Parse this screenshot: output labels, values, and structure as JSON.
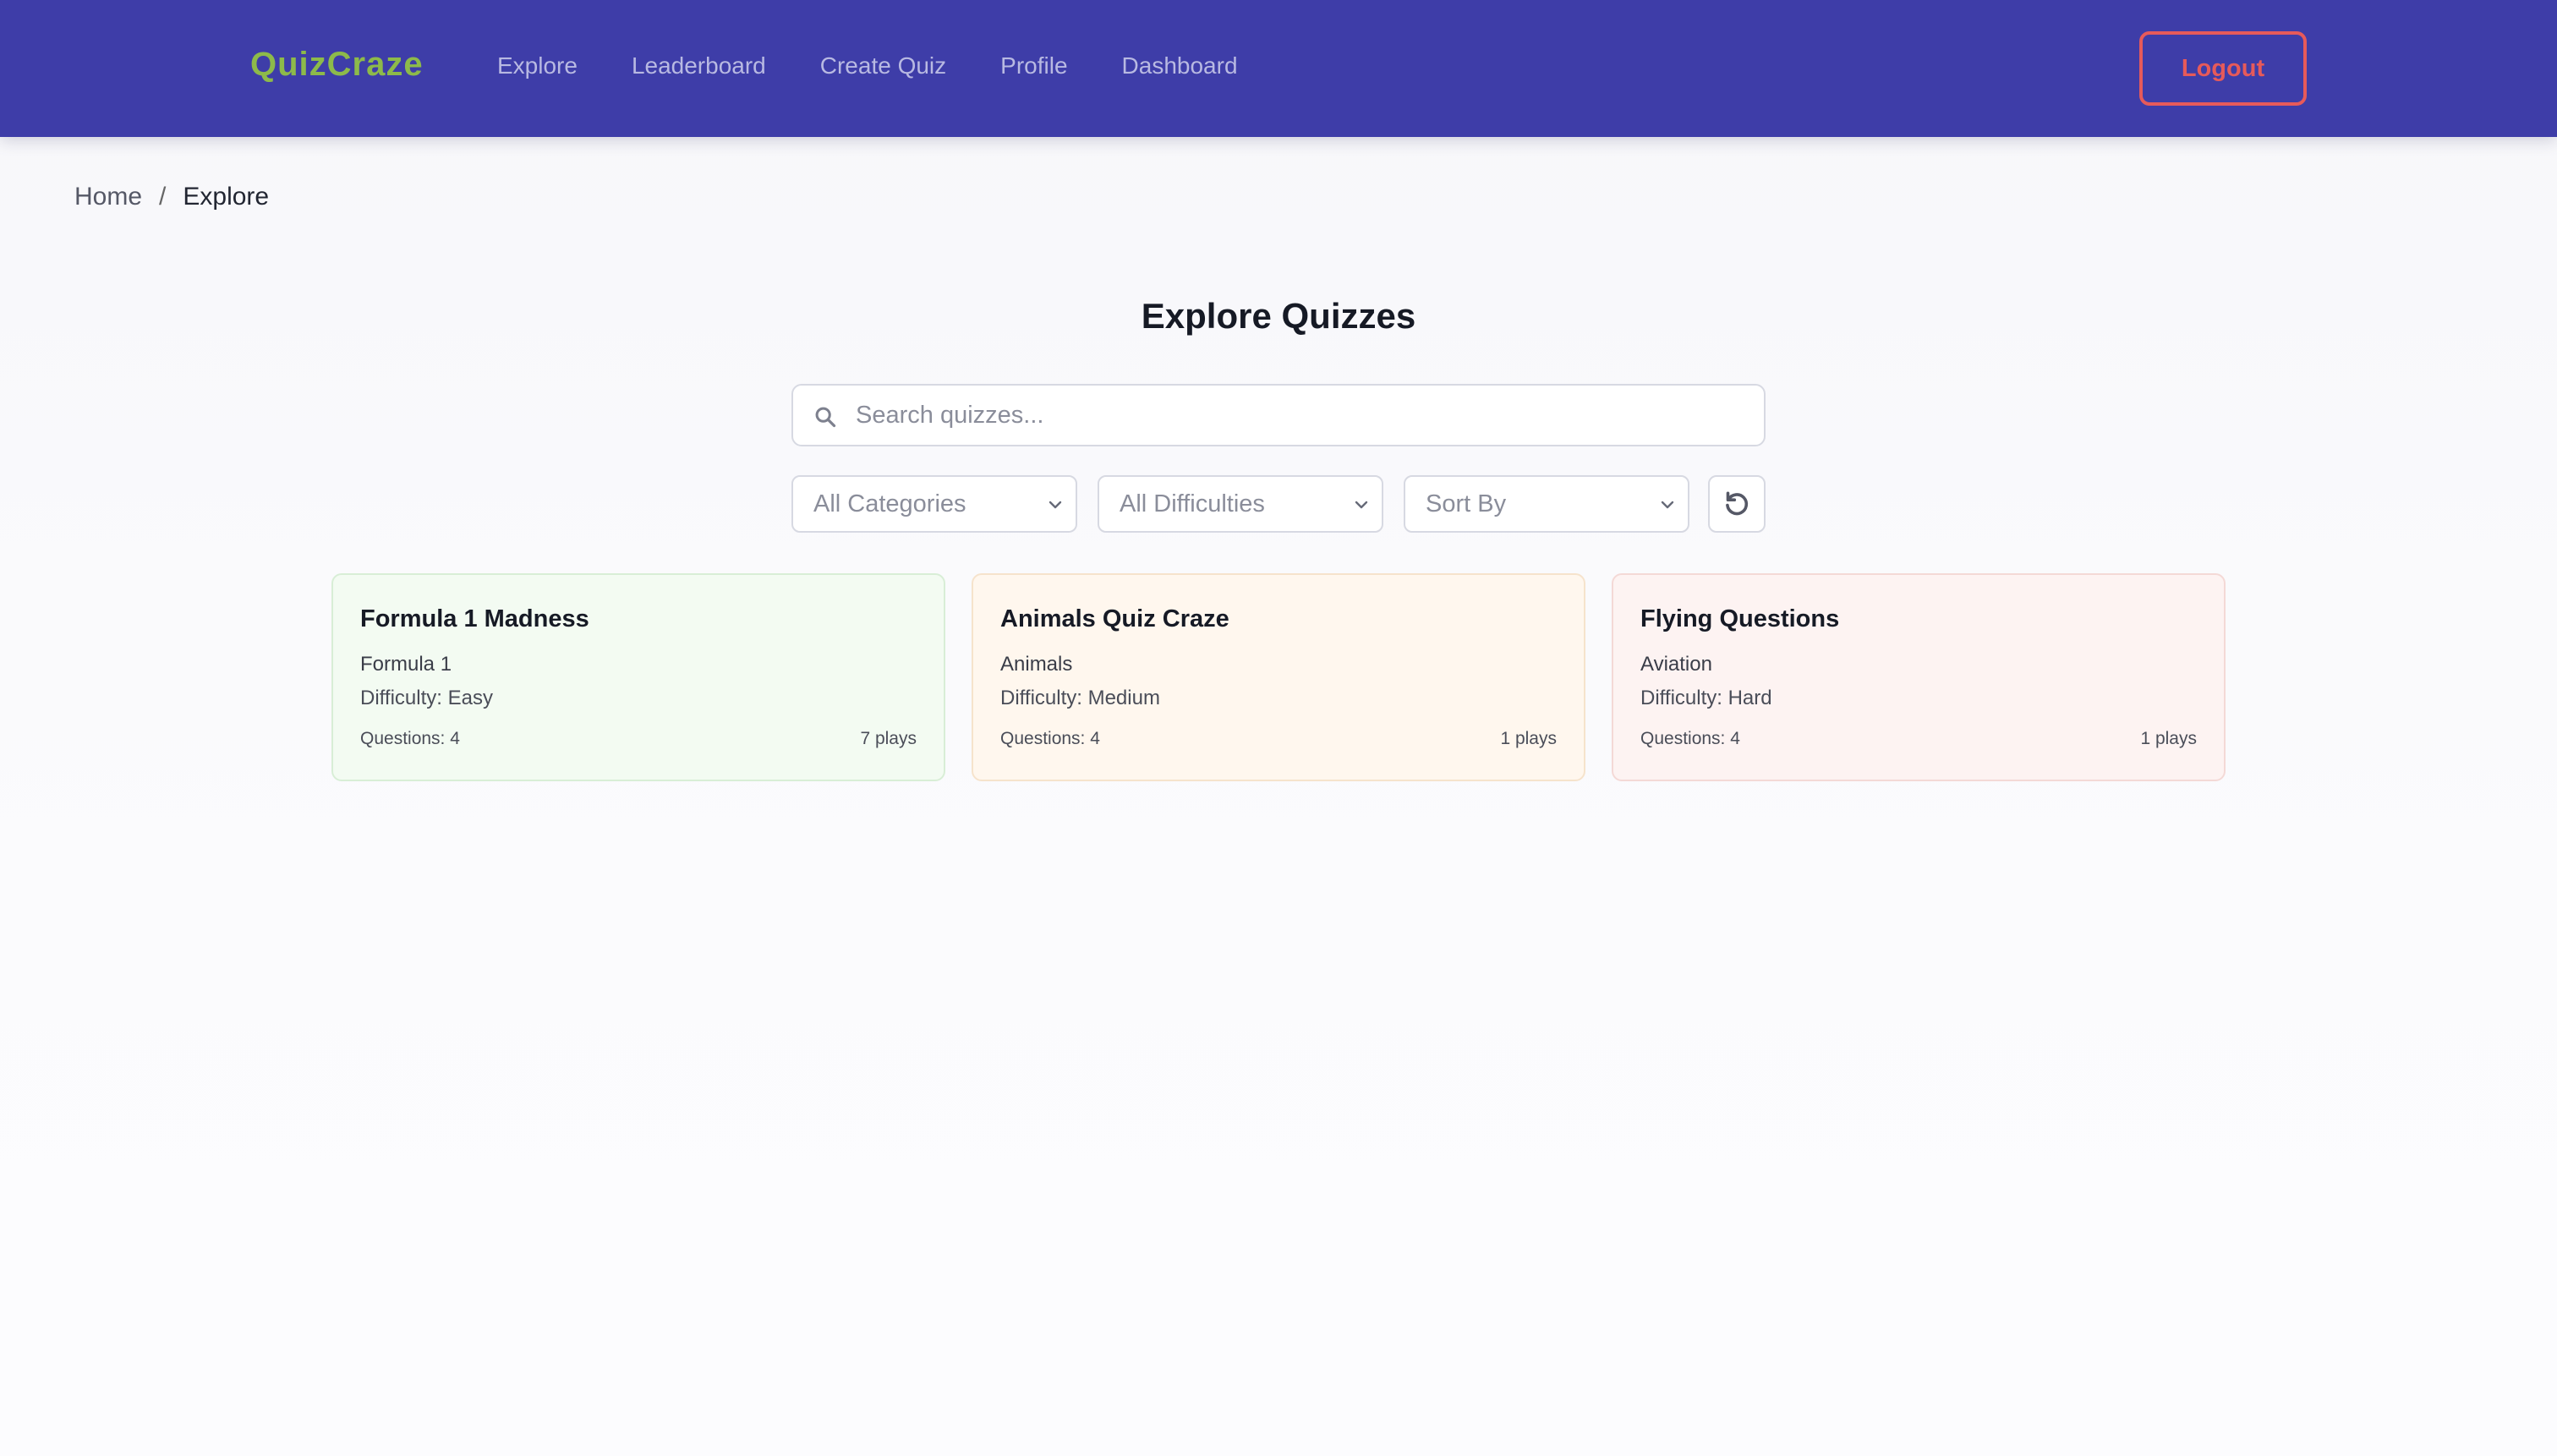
{
  "nav": {
    "brand": "QuizCraze",
    "links": [
      "Explore",
      "Leaderboard",
      "Create Quiz",
      "Profile",
      "Dashboard"
    ],
    "logout_label": "Logout"
  },
  "breadcrumb": {
    "home": "Home",
    "separator": "/",
    "current": "Explore"
  },
  "main": {
    "title": "Explore Quizzes",
    "search_placeholder": "Search quizzes...",
    "filters": {
      "category": "All Categories",
      "difficulty": "All Difficulties",
      "sort": "Sort By"
    }
  },
  "quizzes": [
    {
      "title": "Formula 1 Madness",
      "category": "Formula 1",
      "difficulty": "Difficulty: Easy",
      "questions": "Questions: 4",
      "plays": "7 plays"
    },
    {
      "title": "Animals Quiz Craze",
      "category": "Animals",
      "difficulty": "Difficulty: Medium",
      "questions": "Questions: 4",
      "plays": "1 plays"
    },
    {
      "title": "Flying Questions",
      "category": "Aviation",
      "difficulty": "Difficulty: Hard",
      "questions": "Questions: 4",
      "plays": "1 plays"
    }
  ],
  "colors": {
    "nav_bg": "#3e3da8",
    "brand": "#8dba4a",
    "logout": "#e65a5a",
    "easy_bg": "#f3fbf2",
    "medium_bg": "#fff7ee",
    "hard_bg": "#fdf3f2"
  }
}
